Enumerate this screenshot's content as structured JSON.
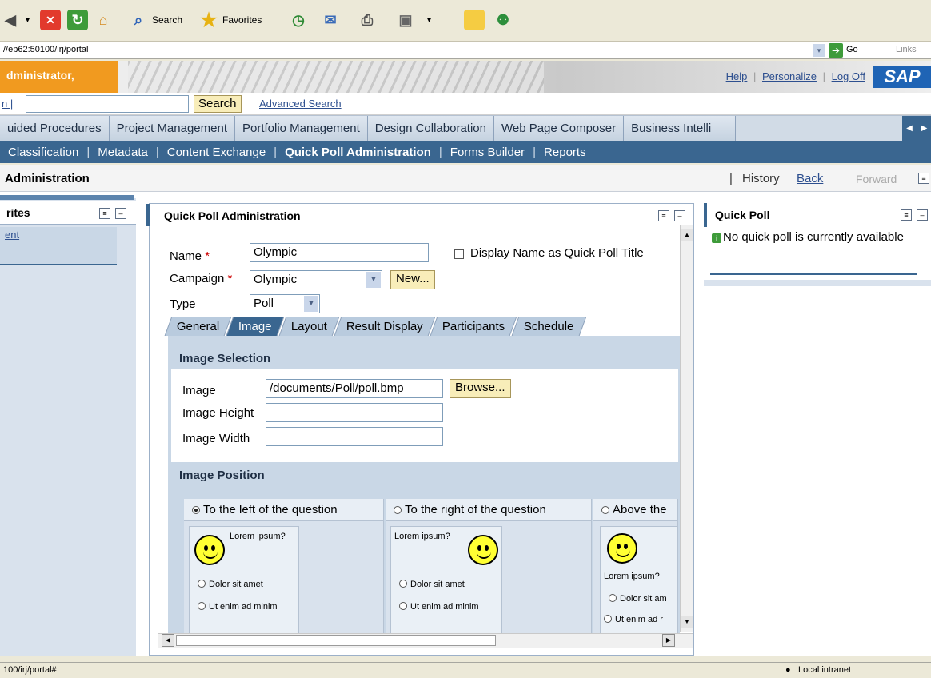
{
  "browser": {
    "toolbar": {
      "search_label": "Search",
      "favorites_label": "Favorites"
    },
    "address": "//ep62:50100/irj/portal",
    "go_label": "Go",
    "links_label": "Links",
    "status_left": "100/irj/portal#",
    "status_zone": "Local intranet"
  },
  "header": {
    "user_greeting": "dministrator,",
    "help": "Help",
    "personalize": "Personalize",
    "logoff": "Log Off",
    "logo": "SAP",
    "search_prefix": "n |",
    "search_button": "Search",
    "advanced_search": "Advanced Search"
  },
  "nav": {
    "level1": [
      "uided Procedures",
      "Project Management",
      "Portfolio Management",
      "Design Collaboration",
      "Web Page Composer",
      "Business Intelli"
    ],
    "level2": [
      "Classification",
      "Metadata",
      "Content Exchange",
      "Quick Poll Administration",
      "Forms Builder",
      "Reports"
    ],
    "active_level2": "Quick Poll Administration"
  },
  "page": {
    "title": "Administration",
    "history": "History",
    "back": "Back",
    "forward": "Forward"
  },
  "left_panel": {
    "title": "rites",
    "item": "ent"
  },
  "main": {
    "title": "Quick Poll Administration",
    "name_label": "Name",
    "name_value": "Olympic",
    "display_name_checkbox": "Display Name as Quick Poll Title",
    "campaign_label": "Campaign",
    "campaign_value": "Olympic",
    "new_button": "New...",
    "type_label": "Type",
    "type_value": "Poll",
    "tabs": [
      "General",
      "Image",
      "Layout",
      "Result Display",
      "Participants",
      "Schedule"
    ],
    "active_tab": "Image",
    "image_selection": {
      "heading": "Image Selection",
      "image_label": "Image",
      "image_value": "/documents/Poll/poll.bmp",
      "browse_button": "Browse...",
      "height_label": "Image Height",
      "width_label": "Image Width"
    },
    "image_position": {
      "heading": "Image Position",
      "options": [
        "To the left of the question",
        "To the right of the question",
        "Above the"
      ],
      "selected": "To the left of the question",
      "preview_question": "Lorem ipsum?",
      "preview_answer_1": "Dolor sit amet",
      "preview_answer_2": "Ut enim ad minim",
      "preview_answer_1_short": "Dolor sit am",
      "preview_answer_2_short": "Ut enim ad r"
    }
  },
  "right_panel": {
    "title": "Quick Poll",
    "message": "No quick poll is currently available"
  },
  "colors": {
    "accent": "#3a6690",
    "user_bar": "#f19a1f",
    "button_yellow": "#f8edb9"
  }
}
